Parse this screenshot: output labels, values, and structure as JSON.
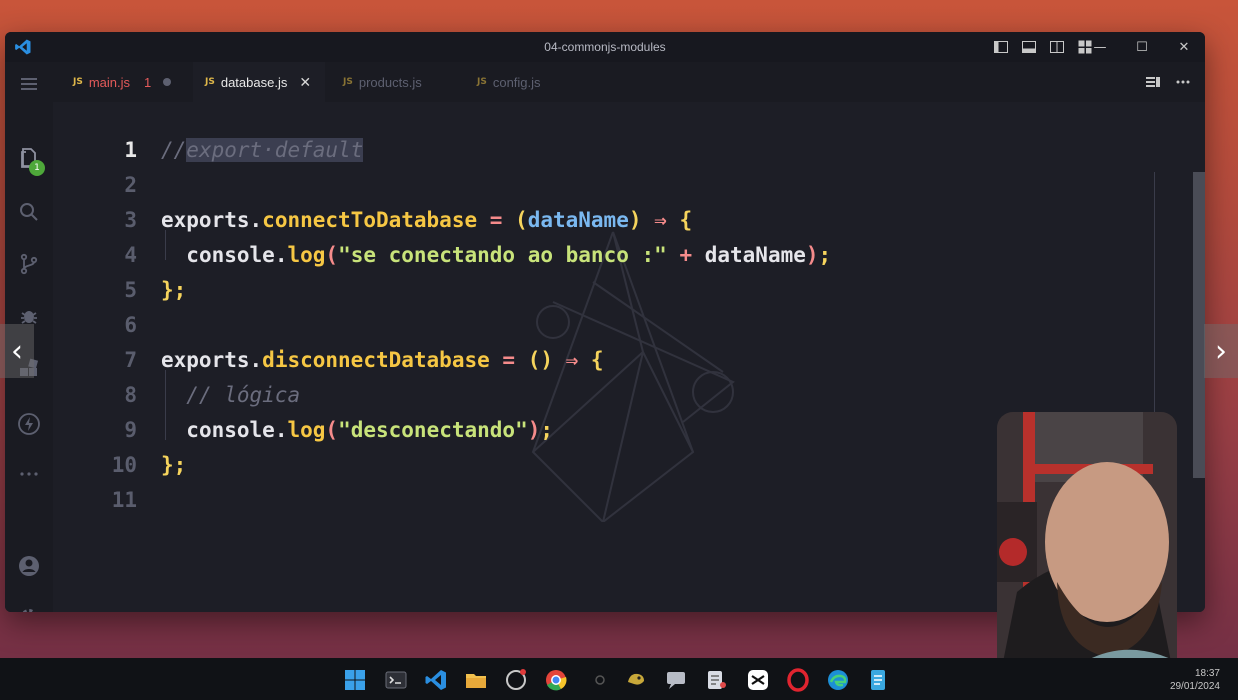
{
  "window": {
    "title": "04-commonjs-modules"
  },
  "activity_bar": {
    "explorer_badge": "1"
  },
  "tabs": [
    {
      "label": "main.js",
      "status": "1",
      "icon": "JS",
      "modified": true
    },
    {
      "label": "database.js",
      "icon": "JS",
      "active": true
    },
    {
      "label": "products.js",
      "icon": "JS"
    },
    {
      "label": "config.js",
      "icon": "JS"
    }
  ],
  "editor": {
    "line_numbers": [
      "1",
      "2",
      "3",
      "4",
      "5",
      "6",
      "7",
      "8",
      "9",
      "10",
      "11"
    ],
    "code": {
      "l1_comment_slashes": "//",
      "l1_comment_selected": "export·default",
      "l3_exports": "exports",
      "l3_dot": ".",
      "l3_name": "connectToDatabase",
      "l3_eq": " = ",
      "l3_paren_open": "(",
      "l3_param": "dataName",
      "l3_paren_close": ")",
      "l3_arrow": " ⇒ ",
      "l3_brace": "{",
      "l4_indent": "  ",
      "l4_console": "console",
      "l4_dot": ".",
      "l4_log": "log",
      "l4_paren_open": "(",
      "l4_string": "\"se conectando ao banco :\"",
      "l4_plus": " + ",
      "l4_var": "dataName",
      "l4_paren_close": ")",
      "l4_semi": ";",
      "l5_close": "}",
      "l5_semi": ";",
      "l7_exports": "exports",
      "l7_dot": ".",
      "l7_name": "disconnectDatabase",
      "l7_eq": " = ",
      "l7_parens": "()",
      "l7_arrow": " ⇒ ",
      "l7_brace": "{",
      "l8_indent": "  ",
      "l8_comment": "// lógica",
      "l9_indent": "  ",
      "l9_console": "console",
      "l9_dot": ".",
      "l9_log": "log",
      "l9_paren_open": "(",
      "l9_string": "\"desconectando\"",
      "l9_paren_close": ")",
      "l9_semi": ";",
      "l10_close": "}",
      "l10_semi": ";"
    }
  },
  "taskbar": {
    "time": "18:37",
    "date": "29/01/2024"
  },
  "colors": {
    "accent_blue": "#0a7bd6",
    "string": "#c8e37a",
    "property": "#f6c744",
    "operator": "#f58b8b",
    "param": "#7ab8f0",
    "modified_tab": "#e35a5a"
  }
}
